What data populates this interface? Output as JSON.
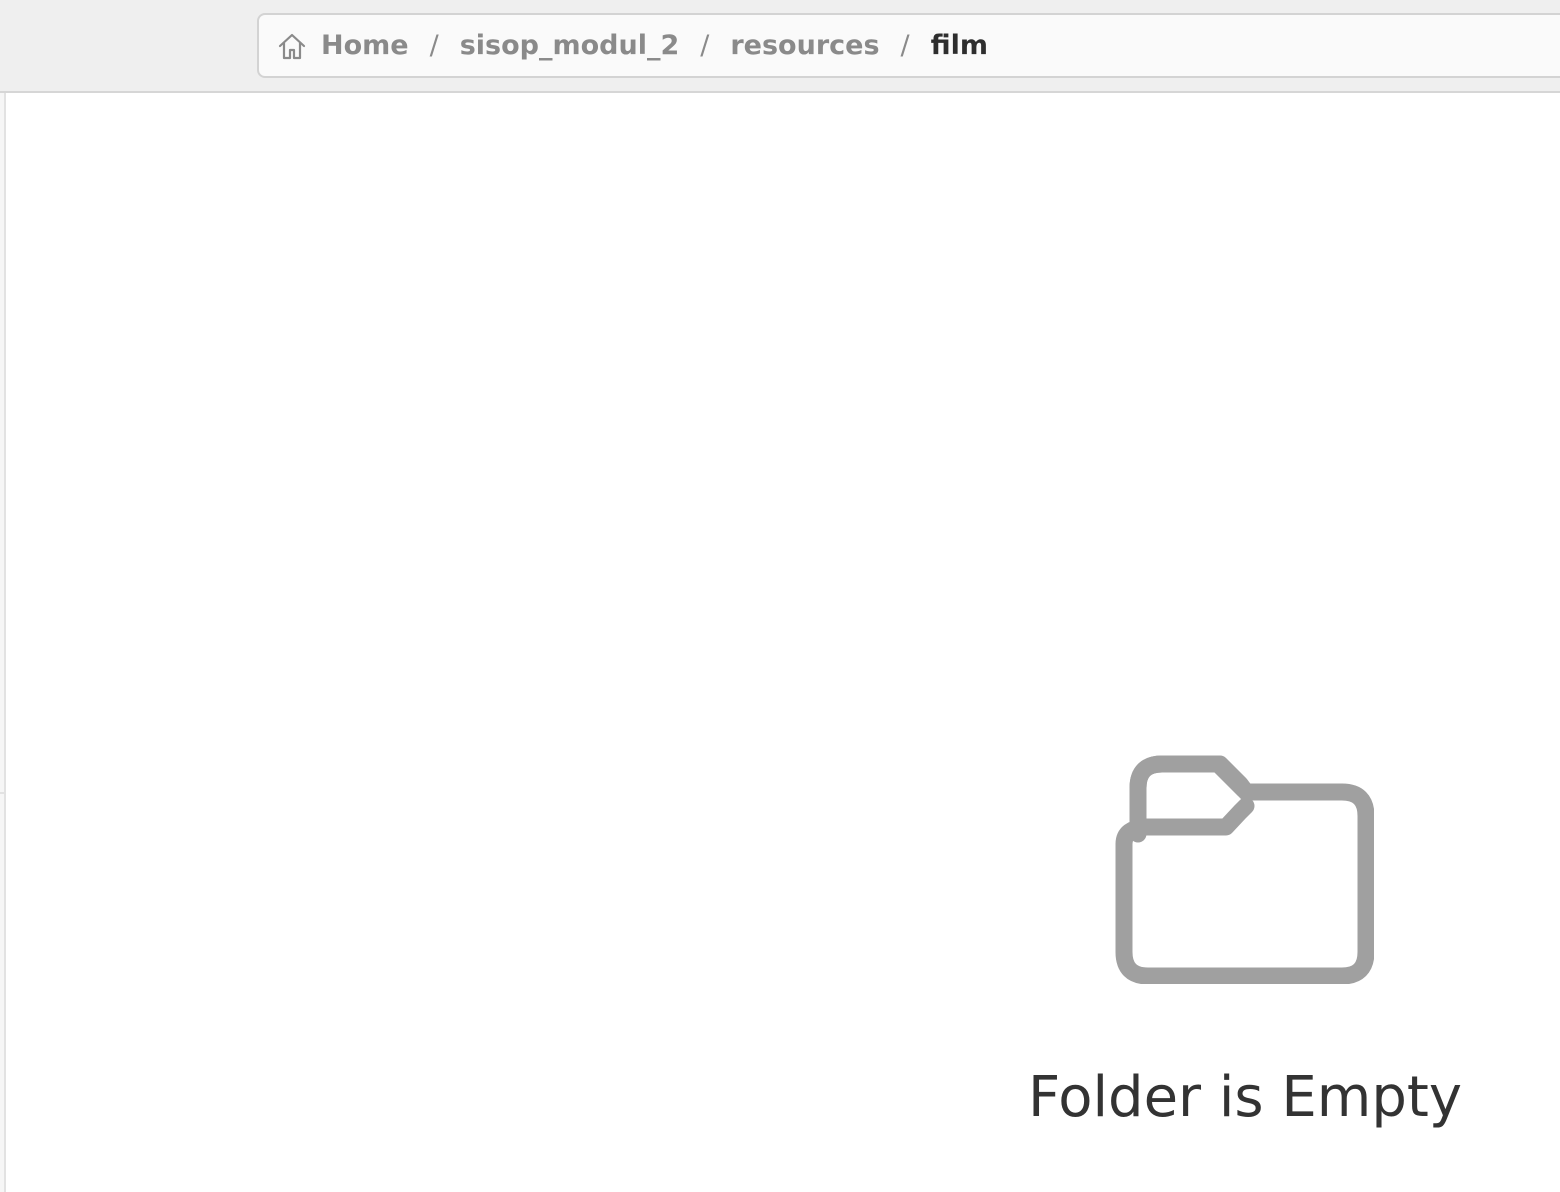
{
  "breadcrumb": {
    "items": [
      {
        "label": "Home",
        "icon": "home-icon"
      },
      {
        "label": "sisop_modul_2"
      },
      {
        "label": "resources"
      },
      {
        "label": "film"
      }
    ],
    "separator": "/"
  },
  "empty_state": {
    "icon": "folder-icon",
    "message": "Folder is Empty"
  },
  "colors": {
    "header_bg": "#efefef",
    "breadcrumb_inactive": "#8a8a8a",
    "breadcrumb_active": "#2e2e2e",
    "folder_icon": "#a0a0a0",
    "empty_text": "#333333"
  }
}
